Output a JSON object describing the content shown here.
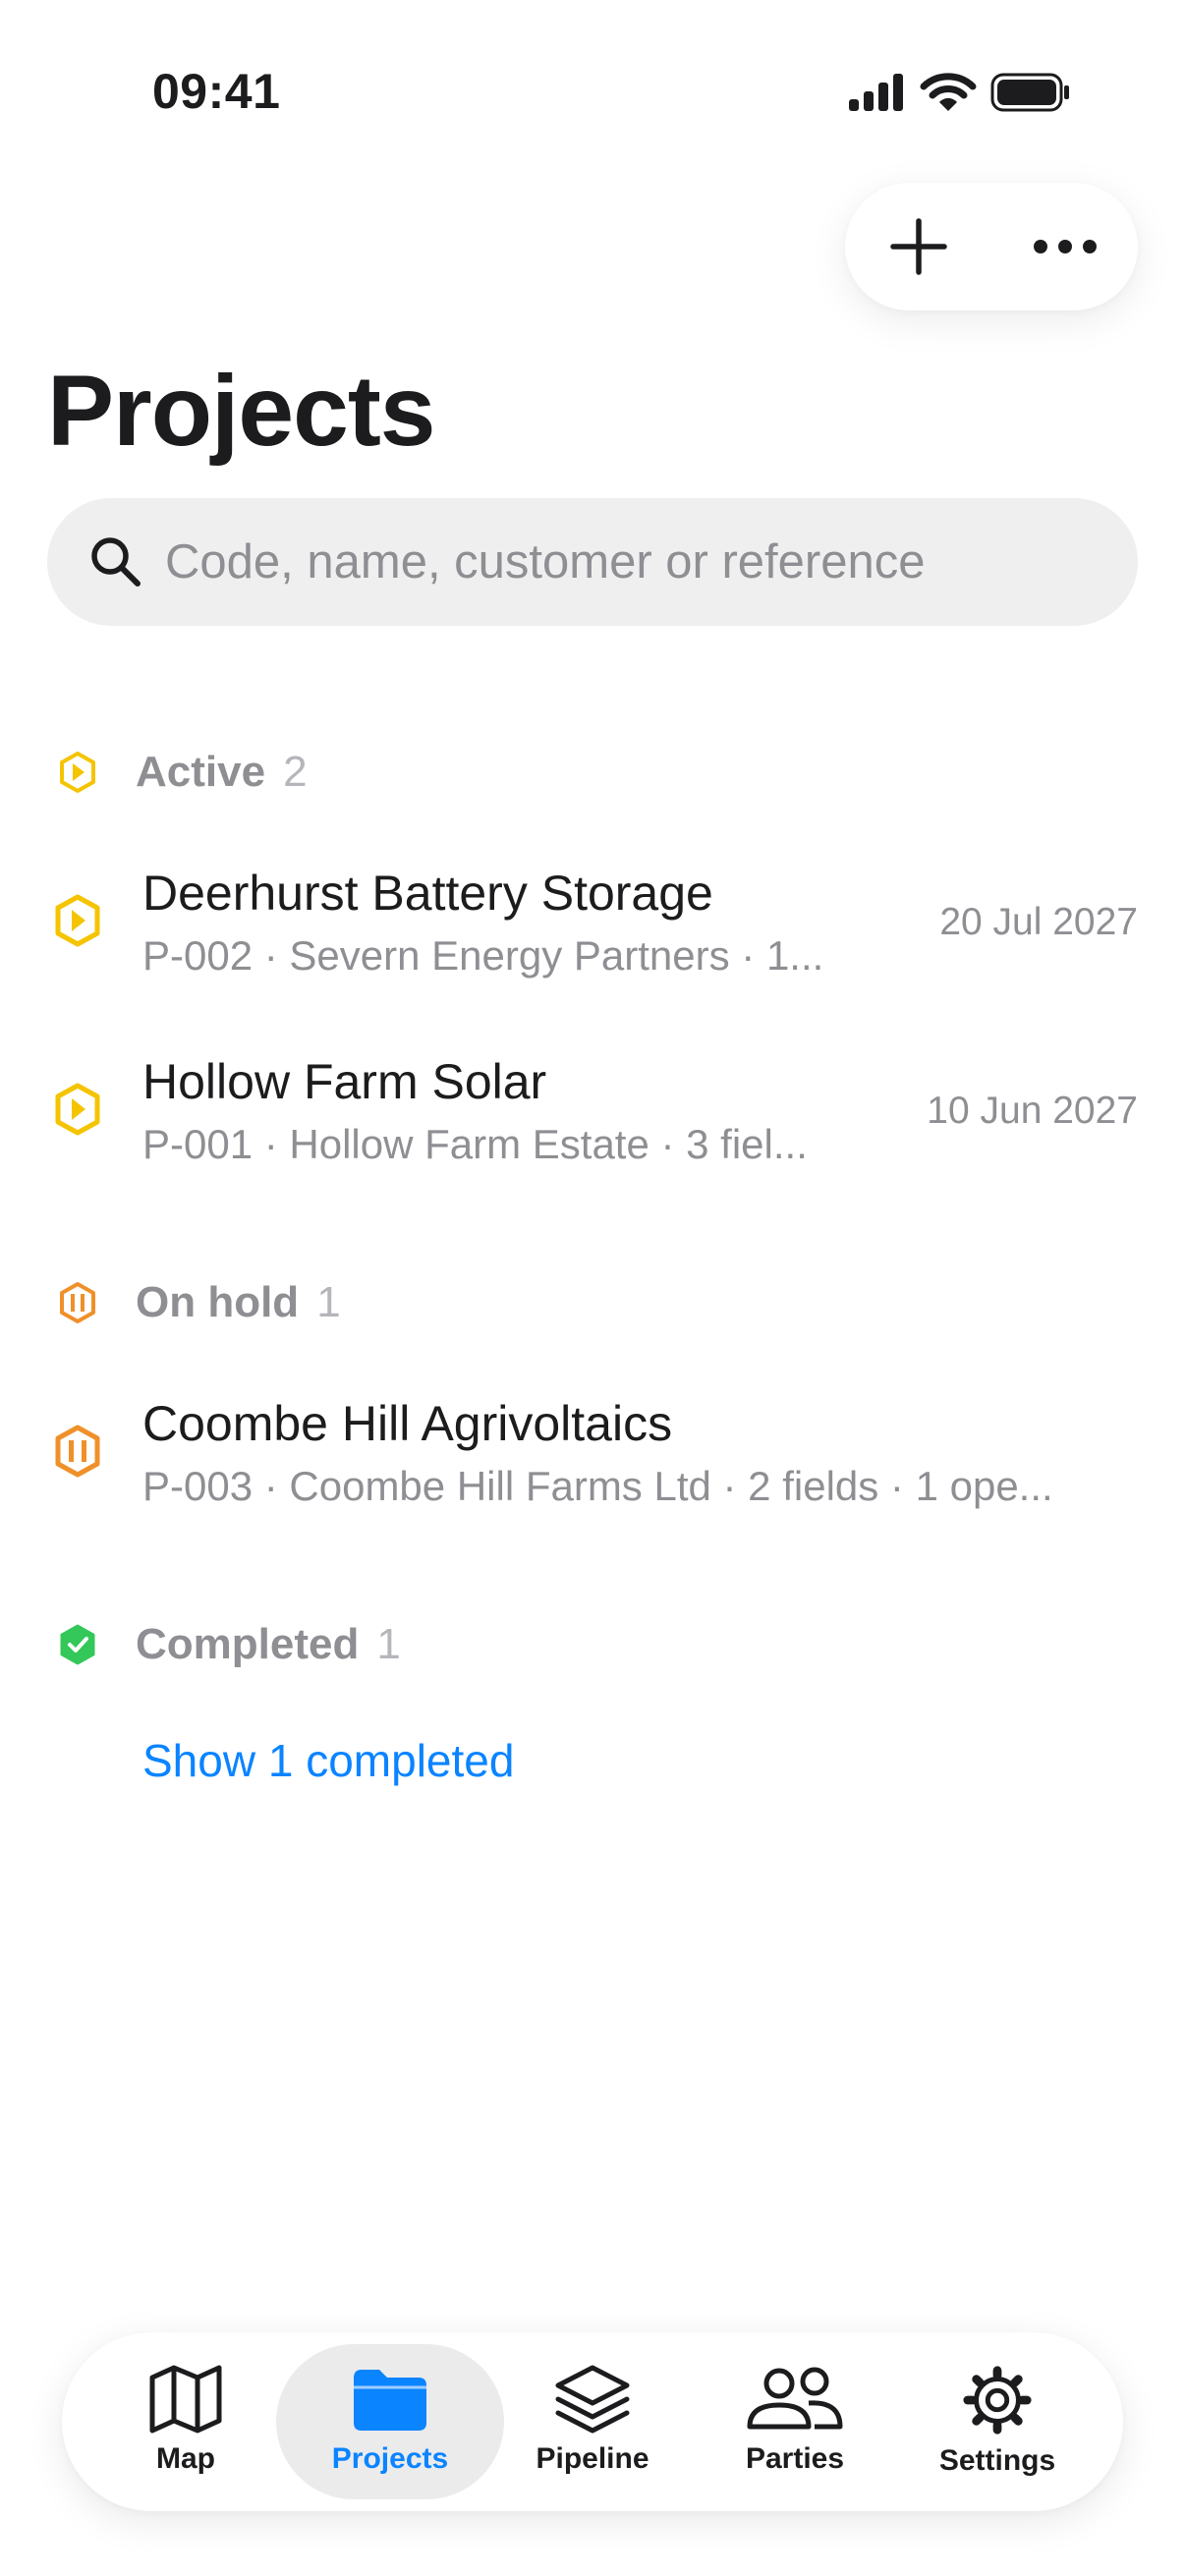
{
  "status_bar": {
    "time": "09:41"
  },
  "header": {
    "title": "Projects"
  },
  "search": {
    "placeholder": "Code, name, customer or reference"
  },
  "colors": {
    "accent": "#0a84ff",
    "active": "#f5c400",
    "on_hold": "#f0902a",
    "completed": "#34c759"
  },
  "sections": {
    "active": {
      "label": "Active",
      "count": "2",
      "items": [
        {
          "title": "Deerhurst Battery Storage",
          "subtitle": "P-002 · Severn Energy Partners · 1...",
          "date": "20 Jul 2027"
        },
        {
          "title": "Hollow Farm Solar",
          "subtitle": "P-001 · Hollow Farm Estate · 3 fiel...",
          "date": "10 Jun 2027"
        }
      ]
    },
    "on_hold": {
      "label": "On hold",
      "count": "1",
      "items": [
        {
          "title": "Coombe Hill Agrivoltaics",
          "subtitle": "P-003 · Coombe Hill Farms Ltd · 2 fields · 1 ope..."
        }
      ]
    },
    "completed": {
      "label": "Completed",
      "count": "1",
      "show_label": "Show 1 completed"
    }
  },
  "tabs": [
    {
      "label": "Map",
      "icon": "map-icon"
    },
    {
      "label": "Projects",
      "icon": "folder-icon",
      "active": true
    },
    {
      "label": "Pipeline",
      "icon": "layers-icon"
    },
    {
      "label": "Parties",
      "icon": "people-icon"
    },
    {
      "label": "Settings",
      "icon": "gear-icon"
    }
  ]
}
